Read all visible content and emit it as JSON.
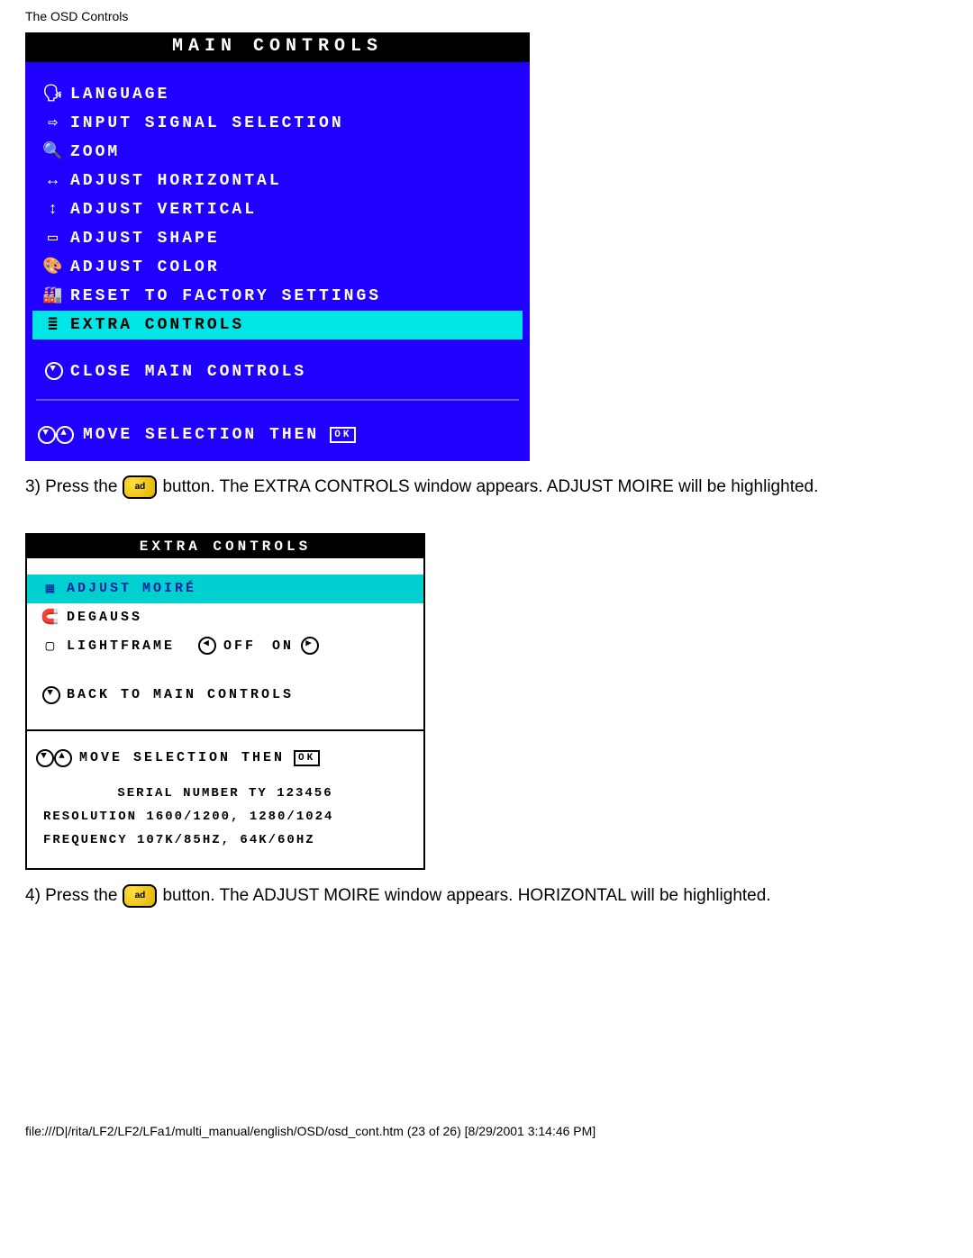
{
  "header": "The OSD Controls",
  "osd1": {
    "title": "MAIN CONTROLS",
    "items": [
      {
        "icon": "🗣",
        "label": "LANGUAGE",
        "hl": false
      },
      {
        "icon": "⇨",
        "label": "INPUT SIGNAL SELECTION",
        "hl": false
      },
      {
        "icon": "🔍",
        "label": "ZOOM",
        "hl": false
      },
      {
        "icon": "↔",
        "label": "ADJUST HORIZONTAL",
        "hl": false
      },
      {
        "icon": "↕",
        "label": "ADJUST VERTICAL",
        "hl": false
      },
      {
        "icon": "▭",
        "label": "ADJUST SHAPE",
        "hl": false
      },
      {
        "icon": "🎨",
        "label": "ADJUST COLOR",
        "hl": false
      },
      {
        "icon": "🏭",
        "label": "RESET TO FACTORY SETTINGS",
        "hl": false
      },
      {
        "icon": "≣",
        "label": "EXTRA CONTROLS",
        "hl": true
      }
    ],
    "close": "CLOSE MAIN CONTROLS",
    "footer": "MOVE SELECTION THEN",
    "ok": "OK"
  },
  "instr3_a": "3) Press the",
  "instr3_b": "button. The EXTRA CONTROLS window appears. ADJUST MOIRE will be highlighted.",
  "osd2": {
    "title": "EXTRA CONTROLS",
    "items": [
      {
        "icon": "▦",
        "label": "ADJUST MOIRÉ",
        "hl": true
      },
      {
        "icon": "🧲",
        "label": "DEGAUSS",
        "hl": false
      }
    ],
    "lightframe": {
      "icon": "▢",
      "label": "LIGHTFRAME",
      "off": "OFF",
      "on": "ON"
    },
    "back": "BACK TO MAIN CONTROLS",
    "footer": "MOVE SELECTION THEN",
    "ok": "OK",
    "serial": "SERIAL NUMBER TY 123456",
    "resolution": "RESOLUTION 1600/1200, 1280/1024",
    "frequency": "FREQUENCY 107K/85HZ, 64K/60HZ"
  },
  "instr4_a": "4) Press the",
  "instr4_b": "button. The ADJUST MOIRE window appears. HORIZONTAL will be highlighted.",
  "footer": "file:///D|/rita/LF2/LF2/LFa1/multi_manual/english/OSD/osd_cont.htm (23 of 26) [8/29/2001 3:14:46 PM]"
}
